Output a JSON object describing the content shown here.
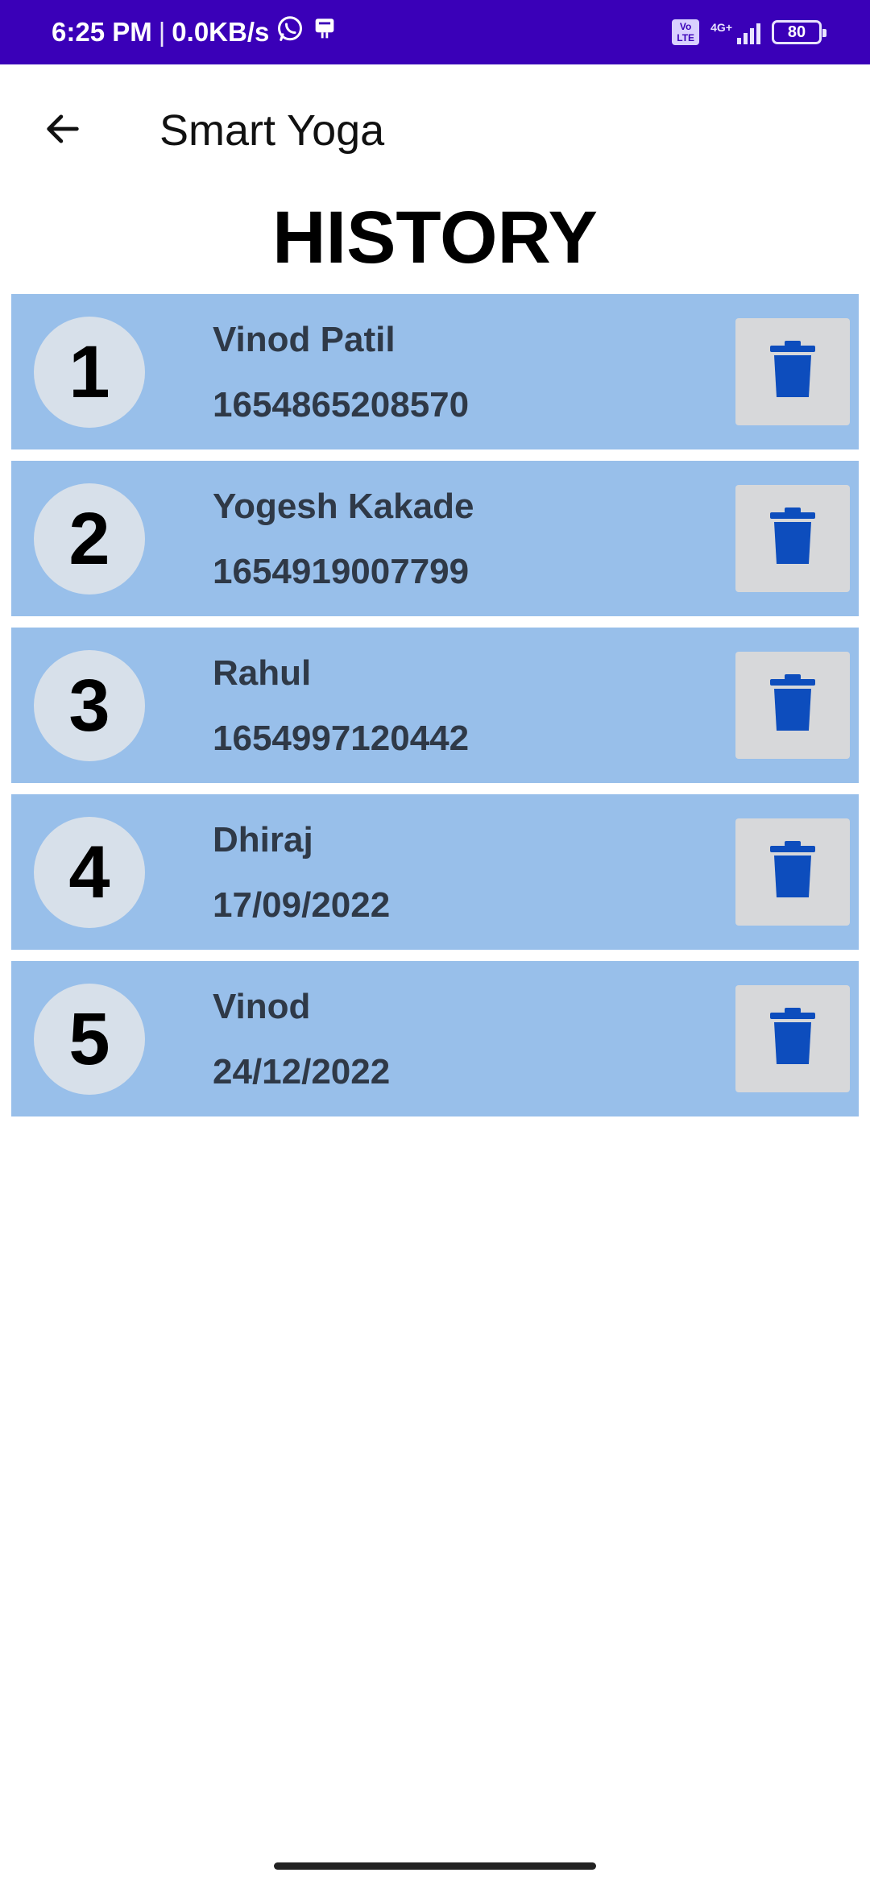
{
  "status_bar": {
    "time": "6:25 PM",
    "separator": "|",
    "speed": "0.0KB/s",
    "volte_top": "Vo",
    "volte_bottom": "LTE",
    "network": "4G+",
    "battery": "80"
  },
  "app_bar": {
    "title": "Smart Yoga"
  },
  "page": {
    "title": "HISTORY"
  },
  "history": [
    {
      "number": "1",
      "name": "Vinod Patil",
      "value": "1654865208570"
    },
    {
      "number": "2",
      "name": "Yogesh Kakade",
      "value": "1654919007799"
    },
    {
      "number": "3",
      "name": "Rahul",
      "value": "1654997120442"
    },
    {
      "number": "4",
      "name": "Dhiraj",
      "value": "17/09/2022"
    },
    {
      "number": "5",
      "name": "Vinod",
      "value": "24/12/2022"
    }
  ],
  "colors": {
    "status_bar": "#3a00b8",
    "item_background": "#98bfea",
    "delete_icon": "#0d4dbd"
  },
  "icons": {
    "back": "arrow-left-icon",
    "delete": "trash-icon"
  }
}
